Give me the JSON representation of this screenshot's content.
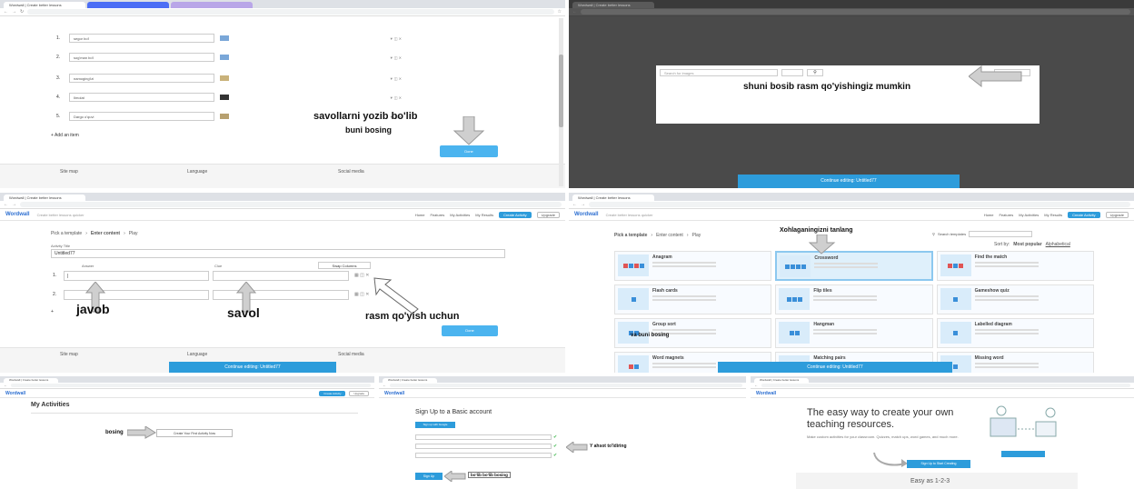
{
  "colors": {
    "accent": "#2d9cdb",
    "button": "#4bb4ef",
    "dark_overlay": "#4a4a4a"
  },
  "browser": {
    "tab_wordwall": "Wordwall | Create better lessons"
  },
  "site": {
    "logo": "Wordwall",
    "tagline": "Create better lessons quicker",
    "nav": [
      "Home",
      "Features",
      "My Activities",
      "My Results"
    ],
    "create_activity": "Create Activity",
    "upgrade": "Upgrade"
  },
  "panel1": {
    "items": [
      {
        "num": "1.",
        "text": "segor bo'l"
      },
      {
        "num": "2.",
        "text": "sog'man bo'l"
      },
      {
        "num": "3.",
        "text": "namoging'izi"
      },
      {
        "num": "4.",
        "text": "Ilmolat"
      },
      {
        "num": "5.",
        "text": "Dargo o'quvi"
      }
    ],
    "add_item": "Add an item",
    "done": "Done",
    "annot_write": "savollarni yozib bo'lib",
    "annot_press": "buni bosing",
    "footer": [
      "Site map",
      "Language",
      "Social media"
    ]
  },
  "panel2": {
    "search_placeholder": "Search for images",
    "annot": "shuni bosib rasm qo'yishingiz mumkin",
    "continue": "Continue editing: Untitled77"
  },
  "panel3": {
    "breadcrumb": [
      "Pick a template",
      "Enter content",
      "Play"
    ],
    "activity_title_label": "Activity Title",
    "activity_title": "Untitled77",
    "col_answer": "Answer",
    "col_clue": "Clue",
    "swap_columns": "Swap Columns",
    "row1_num": "1.",
    "row1_value": "|",
    "row2_num": "2.",
    "annot_answer": "javob",
    "annot_question": "savol",
    "annot_image": "rasm qo'yish uchun",
    "done": "Done",
    "continue": "Continue editing: Untitled77",
    "footer": [
      "Site map",
      "Language",
      "Social media"
    ]
  },
  "panel4": {
    "breadcrumb": [
      "Pick a template",
      "Enter content",
      "Play"
    ],
    "annot_choose": "Xohlaganingizni tanlang",
    "search_templates": "Search templates",
    "sort_by": "Sort by:",
    "sort_popular": "Most popular",
    "sort_alpha": "Alphabetical",
    "templates": [
      "Anagram",
      "Crossword",
      "Find the match",
      "Flash cards",
      "Flip tiles",
      "Gameshow quiz",
      "Group sort",
      "Hangman",
      "Labelled diagram",
      "Word magnets",
      "Matching pairs",
      "Missing word"
    ],
    "annot_press": "va buni bosing",
    "continue": "Continue editing: Untitled77"
  },
  "panel5": {
    "title": "My Activities",
    "annot": "bosing",
    "create_first": "Create Your First Activity Now"
  },
  "panel6": {
    "title": "Sign Up to a Basic account",
    "google_button": "Sign up with Google",
    "sign_up_button": "Sign Up",
    "annot_info": "Y ahsot to'ldiring",
    "annot_press": "bo'lib bo'lib bosing"
  },
  "panel7": {
    "headline": "The easy way to create your own teaching resources.",
    "subtext": "Make custom activities for your classroom. Quizzes, match ups, word games, and much more.",
    "cta": "Sign Up to Start Creating",
    "easy": "Easy as 1-2-3"
  }
}
